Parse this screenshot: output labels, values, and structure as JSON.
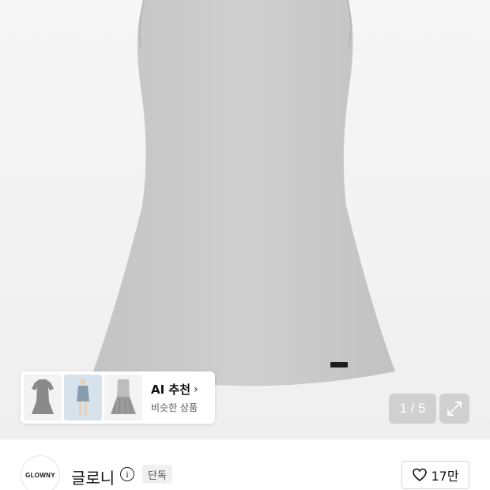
{
  "product_image": {
    "description_icon": "dress-photo",
    "tag_text": "GLOWNY",
    "counter": "1 / 5"
  },
  "ai_recommend": {
    "title": "AI 추천",
    "subtitle": "비슷한 상품",
    "thumbnails": [
      "gray-dress-thumb",
      "model-thumb",
      "pleated-dress-thumb"
    ]
  },
  "brand": {
    "logo_text": "GLOWNY",
    "name": "글로니",
    "badge": "단독"
  },
  "like": {
    "count": "17만"
  },
  "colors": {
    "dress": "#c9c9c9",
    "counter_bg": "#bebebe"
  }
}
